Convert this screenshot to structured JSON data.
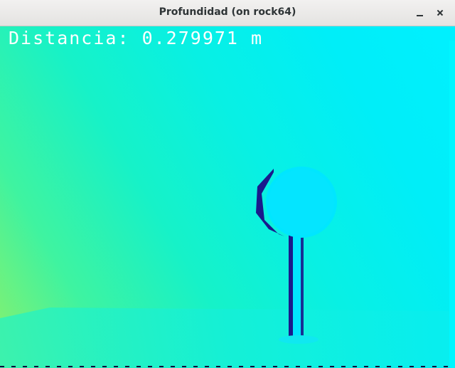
{
  "window": {
    "title": "Profundidad (on rock64)"
  },
  "depth_view": {
    "overlay_text": "Distancia: 0.279971 m"
  },
  "colors": {
    "near_obstacle": "#00e6ff",
    "shadow_edge": "#1a1a8c",
    "floor": "#18f2d6",
    "far_green": "#8cf06a"
  }
}
